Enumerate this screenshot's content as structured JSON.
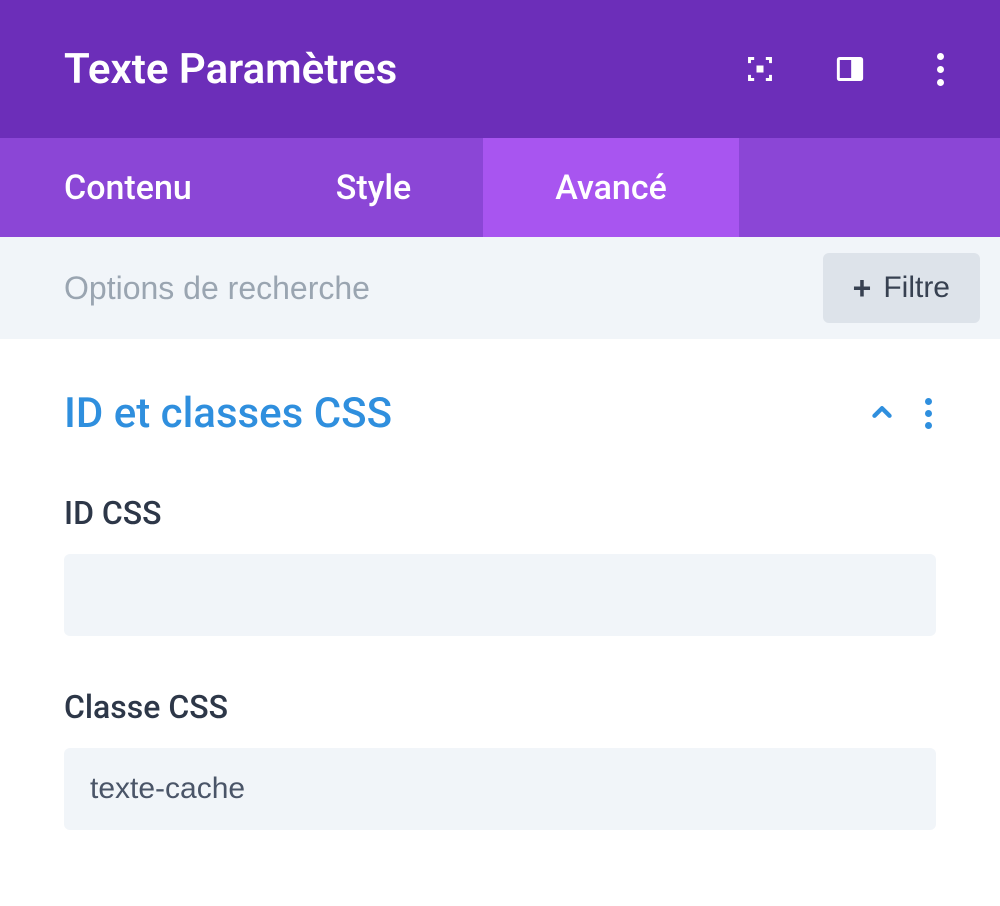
{
  "header": {
    "title": "Texte Paramètres"
  },
  "tabs": [
    {
      "label": "Contenu",
      "active": false
    },
    {
      "label": "Style",
      "active": false
    },
    {
      "label": "Avancé",
      "active": true
    }
  ],
  "search": {
    "placeholder": "Options de recherche",
    "filter_label": "Filtre"
  },
  "section": {
    "title": "ID et classes CSS",
    "fields": {
      "id_css": {
        "label": "ID CSS",
        "value": ""
      },
      "classe_css": {
        "label": "Classe CSS",
        "value": "texte-cache"
      }
    }
  }
}
